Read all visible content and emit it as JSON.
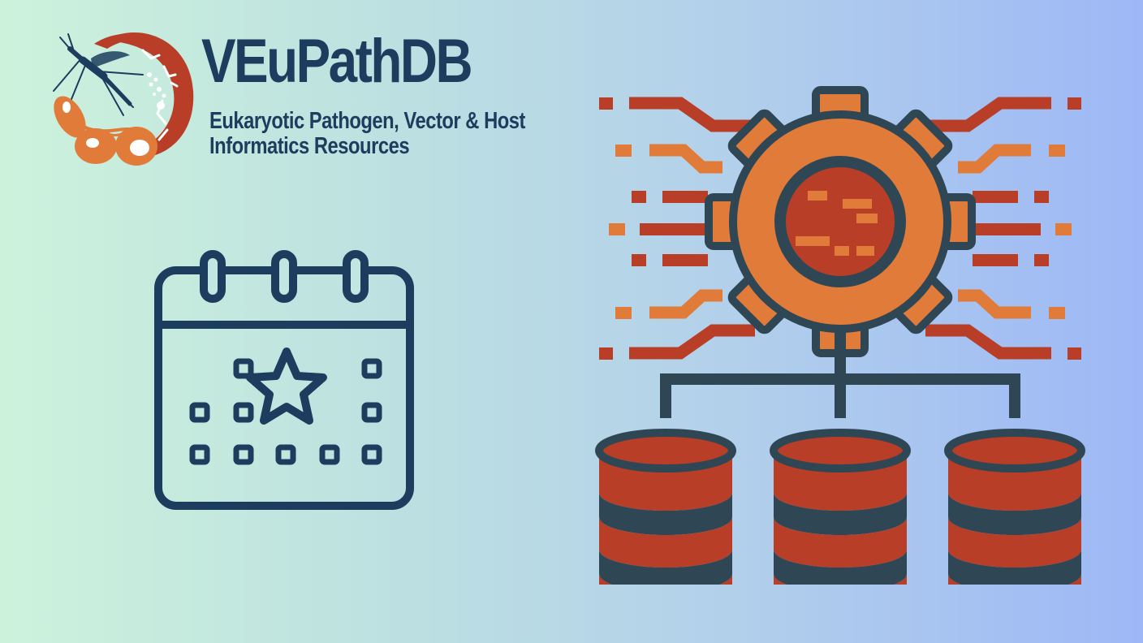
{
  "brand": {
    "name": "VEuPathDB",
    "tagline_line1": "Eukaryotic Pathogen, Vector & Host",
    "tagline_line2": "Informatics Resources"
  },
  "icons": {
    "logo": "veupathdb-logo-icon",
    "calendar": "calendar-star-icon",
    "data_integration": "gear-database-icon"
  },
  "colors": {
    "navy": "#1d3d5e",
    "slate": "#2f4654",
    "orange": "#e07b39",
    "rust": "#b83e27"
  }
}
